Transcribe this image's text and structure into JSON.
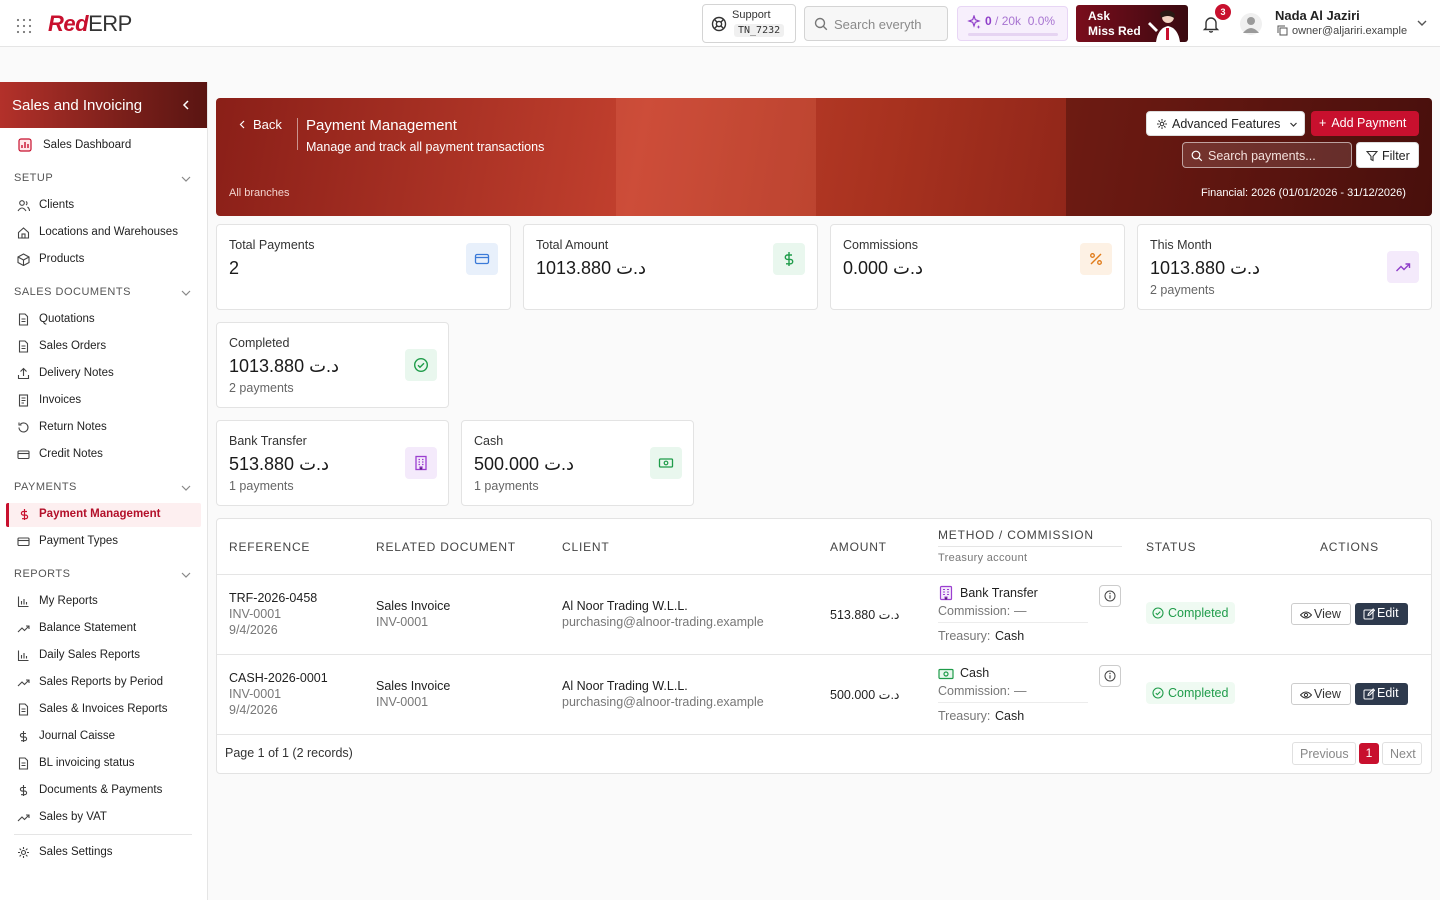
{
  "topbar": {
    "logo_red": "Red",
    "logo_erp": "ERP",
    "support_label": "Support",
    "support_code": "TN_7232",
    "search_placeholder": "Search everyth",
    "credits_used": "0",
    "credits_limit": "/ 20k",
    "credits_percent": "0.0%",
    "credits_fraction": 0,
    "ask_line1": "Ask",
    "ask_line2": "Miss Red",
    "notification_count": "3",
    "user_name": "Nada Al Jaziri",
    "user_email": "owner@aljariri.example"
  },
  "sidebar": {
    "title": "Sales and Invoicing",
    "dashboard": "Sales Dashboard",
    "sections": {
      "setup": "SETUP",
      "sales_documents": "SALES DOCUMENTS",
      "payments": "PAYMENTS",
      "reports": "REPORTS"
    },
    "setup_items": [
      "Clients",
      "Locations and Warehouses",
      "Products"
    ],
    "doc_items": [
      "Quotations",
      "Sales Orders",
      "Delivery Notes",
      "Invoices",
      "Return Notes",
      "Credit Notes"
    ],
    "payment_items": [
      "Payment Management",
      "Payment Types"
    ],
    "report_items": [
      "My Reports",
      "Balance Statement",
      "Daily Sales Reports",
      "Sales Reports by Period",
      "Sales & Invoices Reports",
      "Journal Caisse",
      "BL invoicing status",
      "Documents & Payments",
      "Sales by VAT"
    ],
    "settings": "Sales Settings"
  },
  "banner": {
    "back": "Back",
    "title": "Payment Management",
    "subtitle": "Manage and track all payment transactions",
    "branch": "All branches",
    "financial": "Financial: 2026 (01/01/2026 - 31/12/2026)",
    "advanced_features": "Advanced Features",
    "add_payment": "Add Payment",
    "search_placeholder": "Search payments...",
    "filter": "Filter"
  },
  "stats": {
    "total_payments": {
      "title": "Total Payments",
      "value": "2"
    },
    "total_amount": {
      "title": "Total Amount",
      "value": "1013.880 د.ت"
    },
    "commissions": {
      "title": "Commissions",
      "value": "0.000 د.ت"
    },
    "this_month": {
      "title": "This Month",
      "value": "1013.880 د.ت",
      "sub": "2 payments"
    },
    "completed": {
      "title": "Completed",
      "value": "1013.880 د.ت",
      "sub": "2 payments"
    },
    "bank_transfer": {
      "title": "Bank Transfer",
      "value": "513.880 د.ت",
      "sub": "1 payments"
    },
    "cash": {
      "title": "Cash",
      "value": "500.000 د.ت",
      "sub": "1 payments"
    }
  },
  "table": {
    "headers": {
      "reference": "REFERENCE",
      "related_document": "RELATED DOCUMENT",
      "client": "CLIENT",
      "amount": "AMOUNT",
      "method": "METHOD / COMMISSION",
      "method_sub": "Treasury account",
      "status": "STATUS",
      "actions": "ACTIONS"
    },
    "rows": [
      {
        "reference": "TRF-2026-0458",
        "ref_doc": "INV-0001",
        "date": "9/4/2026",
        "related_type": "Sales Invoice",
        "related_doc": "INV-0001",
        "client_name": "Al Noor Trading W.L.L.",
        "client_email": "purchasing@alnoor-trading.example",
        "amount": "513.880 د.ت",
        "method": "Bank Transfer",
        "commission_label": "Commission:",
        "commission_value": "—",
        "treasury_label": "Treasury:",
        "treasury_value": "Cash",
        "status": "Completed",
        "view": "View",
        "edit": "Edit"
      },
      {
        "reference": "CASH-2026-0001",
        "ref_doc": "INV-0001",
        "date": "9/4/2026",
        "related_type": "Sales Invoice",
        "related_doc": "INV-0001",
        "client_name": "Al Noor Trading W.L.L.",
        "client_email": "purchasing@alnoor-trading.example",
        "amount": "500.000 د.ت",
        "method": "Cash",
        "commission_label": "Commission:",
        "commission_value": "—",
        "treasury_label": "Treasury:",
        "treasury_value": "Cash",
        "status": "Completed",
        "view": "View",
        "edit": "Edit"
      }
    ],
    "page_info": "Page 1 of 1 (2 records)",
    "prev": "Previous",
    "current_page": "1",
    "next": "Next"
  },
  "colors": {
    "brand_red": "#c8102e",
    "status_green": "#1f9c4a",
    "edit_dark": "#2e3a4d"
  }
}
